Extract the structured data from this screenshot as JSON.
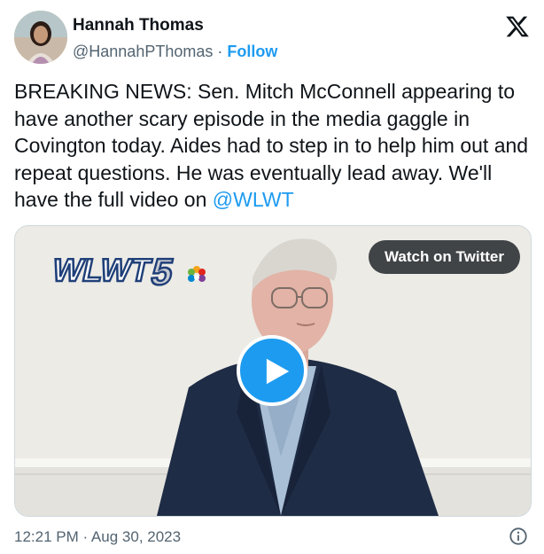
{
  "author": {
    "name": "Hannah Thomas",
    "handle": "@HannahPThomas",
    "separator": "·",
    "follow_label": "Follow"
  },
  "tweet": {
    "text": "BREAKING NEWS: Sen. Mitch McConnell appearing to have another scary episode in the media gaggle in Covington today. Aides had to step in to help him out and repeat questions. He was eventually lead away. We'll have the full video on ",
    "mention": "@WLWT"
  },
  "media": {
    "station_logo_text": "WLWT",
    "station_logo_number": "5",
    "watch_label": "Watch on Twitter",
    "play_icon": "play-icon"
  },
  "footer": {
    "timestamp": "12:21 PM · Aug 30, 2023",
    "info_icon": "info-icon"
  },
  "colors": {
    "accent": "#1d9bf0",
    "text": "#0f1419",
    "secondary": "#536471"
  }
}
